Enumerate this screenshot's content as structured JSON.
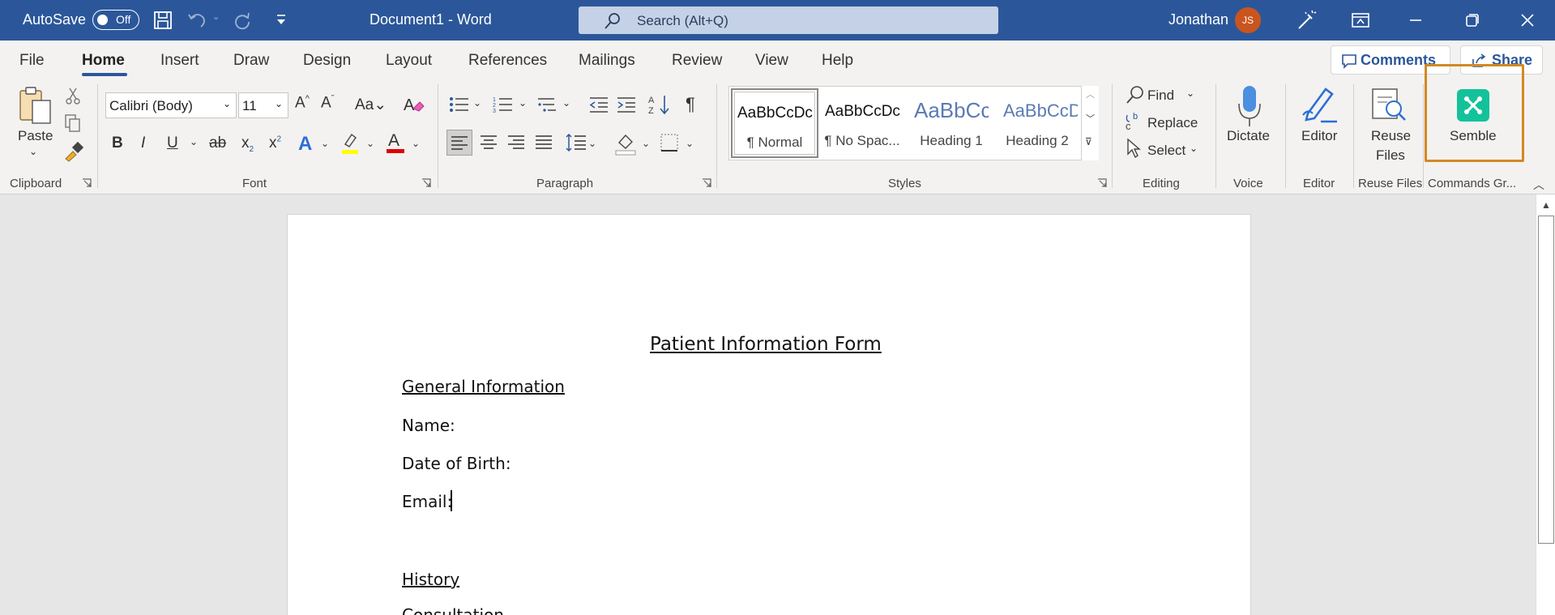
{
  "titlebar": {
    "autosave_label": "AutoSave",
    "autosave_state": "Off",
    "doc_title": "Document1  -  Word",
    "search_placeholder": "Search (Alt+Q)",
    "user_name": "Jonathan",
    "user_initials": "JS"
  },
  "tabs": [
    "File",
    "Home",
    "Insert",
    "Draw",
    "Design",
    "Layout",
    "References",
    "Mailings",
    "Review",
    "View",
    "Help"
  ],
  "active_tab": "Home",
  "top_buttons": {
    "comments": "Comments",
    "share": "Share"
  },
  "ribbon": {
    "clipboard": {
      "paste": "Paste",
      "label": "Clipboard"
    },
    "font": {
      "name": "Calibri (Body)",
      "size": "11",
      "label": "Font"
    },
    "paragraph": {
      "label": "Paragraph"
    },
    "styles": {
      "label": "Styles",
      "items": [
        {
          "sample": "AaBbCcDc",
          "name": "¶ Normal"
        },
        {
          "sample": "AaBbCcDc",
          "name": "¶ No Spac..."
        },
        {
          "sample": "AaBbCc",
          "name": "Heading 1"
        },
        {
          "sample": "AaBbCcD",
          "name": "Heading 2"
        }
      ]
    },
    "editing": {
      "label": "Editing",
      "find": "Find",
      "replace": "Replace",
      "select": "Select"
    },
    "voice": {
      "label": "Voice",
      "dictate": "Dictate"
    },
    "editor": {
      "label": "Editor",
      "button": "Editor"
    },
    "reuse": {
      "label": "Reuse Files",
      "line1": "Reuse",
      "line2": "Files"
    },
    "commands": {
      "label": "Commands Gr...",
      "semble": "Semble"
    }
  },
  "colors": {
    "brand": "#2b579a",
    "semble": "#13c29b",
    "highlight": "#d28a23",
    "avatar": "#c9551d"
  },
  "document": {
    "title": "Patient Information Form",
    "section1": "General Information",
    "name_label": "Name:",
    "dob_label": "Date of Birth:",
    "email_label": "Email:",
    "section2": "History",
    "consultation": "Consultation"
  }
}
